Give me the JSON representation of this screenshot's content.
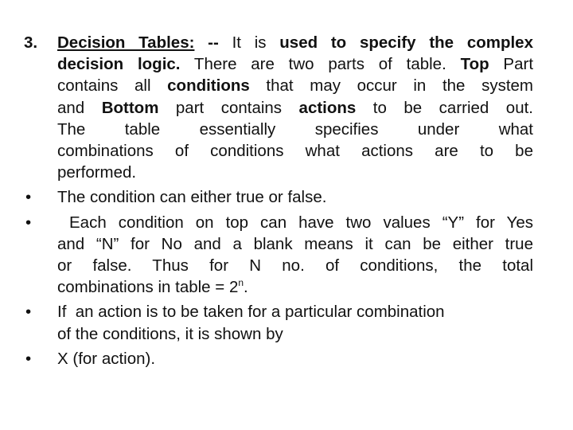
{
  "section": {
    "number": "3.",
    "heading": "Decision Tables:",
    "separator": " -- It is ",
    "lines": {
      "l1_bold": "used to specify the complex",
      "l2_bold": "decision logic.",
      "l2_rest": " There are two parts of table. ",
      "l2_bold2": "Top",
      "l2_rest2": " Part",
      "l3_a": "contains all ",
      "l3_bold": "conditions",
      "l3_b": " that may occur in the system",
      "l4_a": "and ",
      "l4_bold": "Bottom",
      "l4_b": " part contains ",
      "l4_bold2": "actions",
      "l4_c": " to be carried out.",
      "l5": "The table essentially specifies under what",
      "l6": "combinations of conditions what actions are to be",
      "l7": "performed."
    }
  },
  "bullets": [
    {
      "text": "The condition can either true or false."
    },
    {
      "l1": "Each condition on top can have two values “Y” for Yes",
      "l2": "and “N” for No and a blank means it can be either true",
      "l3": "or false. Thus for N no. of conditions, the total",
      "l4_pre": "combinations in table = 2",
      "l4_sup": "n",
      "l4_post": "."
    },
    {
      "l1": "If  an action is to be taken for a particular combination",
      "l2": "of the conditions, it is shown by"
    },
    {
      "text": "X (for action)."
    }
  ]
}
